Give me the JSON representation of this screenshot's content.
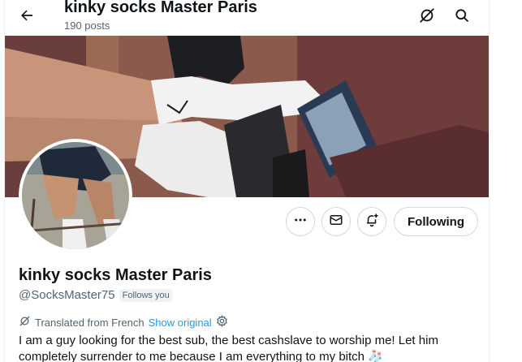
{
  "header": {
    "title": "kinky socks Master Paris",
    "posts_count": "190 posts",
    "back_icon": "arrow-left-icon",
    "translate_icon": "translate-off-icon",
    "search_icon": "search-icon"
  },
  "profile": {
    "display_name": "kinky socks Master Paris",
    "handle": "@SocksMaster75",
    "follows_you": "Follows you",
    "translated_from": "Translated from French",
    "show_original": "Show original",
    "bio": "I am a guy looking for the best sub, the best cashslave to worship me! Let him completely surrender to me because I am everything to my bitch 🧦"
  },
  "actions": {
    "more_icon": "more-icon",
    "message_icon": "mail-icon",
    "notify_icon": "bell-plus-icon",
    "follow_label": "Following"
  },
  "colors": {
    "text": "#0f1419",
    "secondary": "#536471",
    "link": "#1d9bf0",
    "border": "#cfd9de"
  }
}
